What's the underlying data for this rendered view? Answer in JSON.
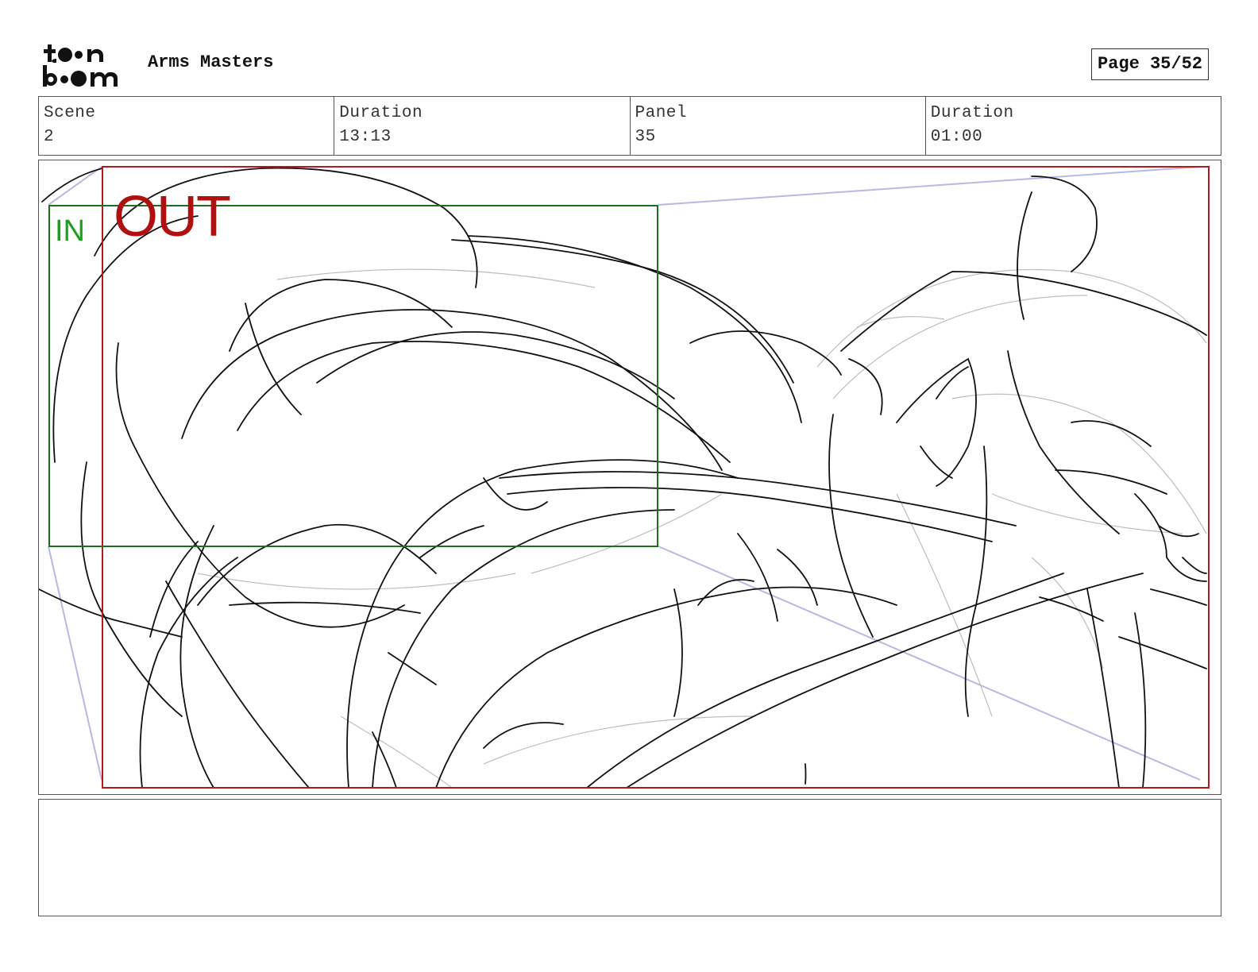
{
  "header": {
    "logo_text": "toon boom",
    "project_title": "Arms Masters",
    "page_label": "Page 35/52"
  },
  "info": {
    "scene_label": "Scene",
    "scene_value": "2",
    "scene_duration_label": "Duration",
    "scene_duration_value": "13:13",
    "panel_label": "Panel",
    "panel_value": "35",
    "panel_duration_label": "Duration",
    "panel_duration_value": "01:00"
  },
  "panel": {
    "in_label": "IN",
    "out_label": "OUT",
    "colors": {
      "in_frame": "#1d6e1d",
      "out_frame": "#b01b1b",
      "camera_guide": "#b8b8e0",
      "sketch": "#111111"
    }
  },
  "notes": {
    "text": ""
  }
}
